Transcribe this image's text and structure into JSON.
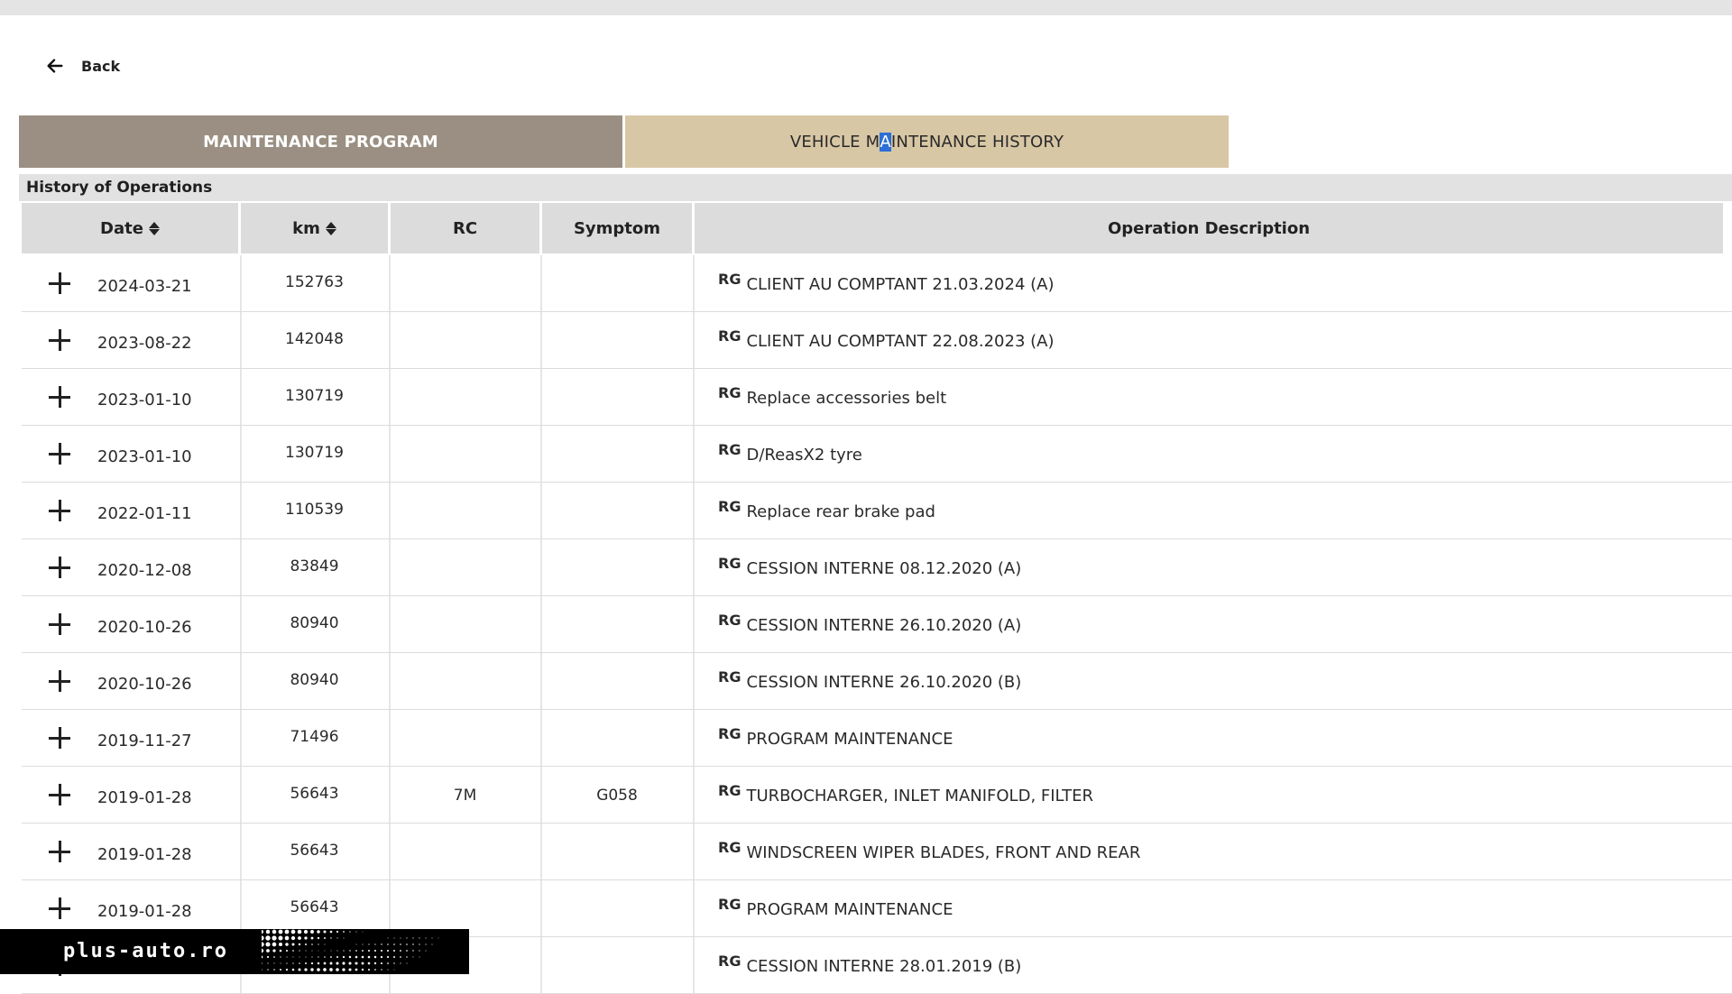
{
  "nav": {
    "back_label": "Back"
  },
  "tabs": [
    {
      "label": "MAINTENANCE PROGRAM",
      "active": false
    },
    {
      "label_pre": "VEHICLE M",
      "label_sel": "A",
      "label_post": "INTENANCE HISTORY",
      "active": true
    }
  ],
  "section": {
    "title": "History of Operations"
  },
  "columns": {
    "date": "Date",
    "km": "km",
    "rc": "RC",
    "symptom": "Symptom",
    "description": "Operation Description"
  },
  "rows": [
    {
      "date": "2024-03-21",
      "km": "152763",
      "rc": "",
      "symptom": "",
      "tag": "RG",
      "description": "CLIENT AU COMPTANT 21.03.2024 (A)"
    },
    {
      "date": "2023-08-22",
      "km": "142048",
      "rc": "",
      "symptom": "",
      "tag": "RG",
      "description": "CLIENT AU COMPTANT 22.08.2023 (A)"
    },
    {
      "date": "2023-01-10",
      "km": "130719",
      "rc": "",
      "symptom": "",
      "tag": "RG",
      "description": "Replace accessories belt"
    },
    {
      "date": "2023-01-10",
      "km": "130719",
      "rc": "",
      "symptom": "",
      "tag": "RG",
      "description": "D/ReasX2 tyre"
    },
    {
      "date": "2022-01-11",
      "km": "110539",
      "rc": "",
      "symptom": "",
      "tag": "RG",
      "description": "Replace rear brake pad"
    },
    {
      "date": "2020-12-08",
      "km": "83849",
      "rc": "",
      "symptom": "",
      "tag": "RG",
      "description": "CESSION INTERNE 08.12.2020 (A)"
    },
    {
      "date": "2020-10-26",
      "km": "80940",
      "rc": "",
      "symptom": "",
      "tag": "RG",
      "description": "CESSION INTERNE 26.10.2020 (A)"
    },
    {
      "date": "2020-10-26",
      "km": "80940",
      "rc": "",
      "symptom": "",
      "tag": "RG",
      "description": "CESSION INTERNE 26.10.2020 (B)"
    },
    {
      "date": "2019-11-27",
      "km": "71496",
      "rc": "",
      "symptom": "",
      "tag": "RG",
      "description": "PROGRAM MAINTENANCE"
    },
    {
      "date": "2019-01-28",
      "km": "56643",
      "rc": "7M",
      "symptom": "G058",
      "tag": "RG",
      "description": "TURBOCHARGER, INLET MANIFOLD, FILTER"
    },
    {
      "date": "2019-01-28",
      "km": "56643",
      "rc": "",
      "symptom": "",
      "tag": "RG",
      "description": "WINDSCREEN WIPER BLADES, FRONT AND REAR"
    },
    {
      "date": "2019-01-28",
      "km": "56643",
      "rc": "",
      "symptom": "",
      "tag": "RG",
      "description": "PROGRAM MAINTENANCE"
    },
    {
      "date": "",
      "km": "",
      "rc": "",
      "symptom": "",
      "tag": "RG",
      "description": "CESSION INTERNE 28.01.2019 (B)"
    }
  ],
  "watermark": {
    "text": "plus-auto.ro"
  },
  "colors": {
    "tab_program": "#9a8f82",
    "tab_history": "#d8c7a5",
    "selection": "#2d6fd6",
    "header_bg": "#dcdcdc"
  }
}
